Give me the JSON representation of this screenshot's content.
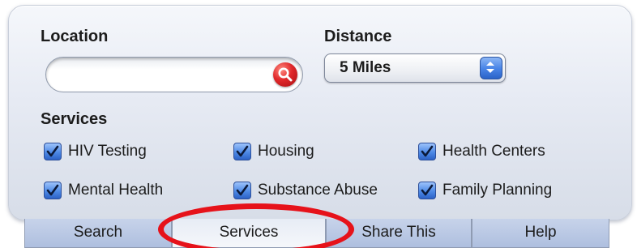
{
  "form": {
    "location_label": "Location",
    "location_value": "",
    "distance_label": "Distance",
    "distance_value": "5 Miles",
    "services_label": "Services"
  },
  "services": [
    {
      "label": "HIV Testing",
      "checked": true
    },
    {
      "label": "Housing",
      "checked": true
    },
    {
      "label": "Health Centers",
      "checked": true
    },
    {
      "label": "Mental Health",
      "checked": true
    },
    {
      "label": "Substance Abuse",
      "checked": true
    },
    {
      "label": "Family Planning",
      "checked": true
    }
  ],
  "tabs": [
    {
      "label": "Search"
    },
    {
      "label": "Services",
      "active": true
    },
    {
      "label": "Share This"
    },
    {
      "label": "Help"
    }
  ],
  "colors": {
    "highlight": "#e6121a",
    "checkbox": "#4e8ae6",
    "search_button": "#e0282a"
  }
}
